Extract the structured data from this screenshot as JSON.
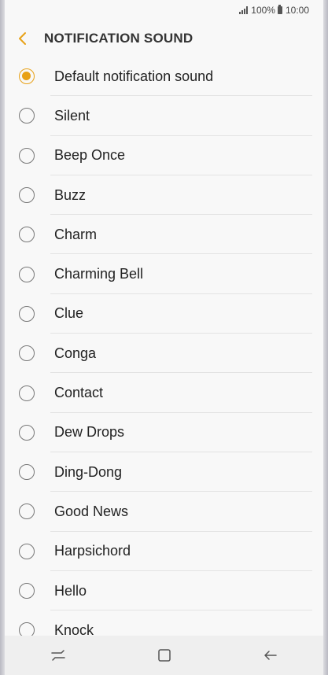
{
  "status_bar": {
    "battery": "100%",
    "time": "10:00"
  },
  "header": {
    "title": "NOTIFICATION SOUND",
    "back_icon": "chevron-left-icon"
  },
  "colors": {
    "accent": "#e8a116"
  },
  "sounds": [
    {
      "label": "Default notification sound",
      "selected": true
    },
    {
      "label": "Silent",
      "selected": false
    },
    {
      "label": "Beep Once",
      "selected": false
    },
    {
      "label": "Buzz",
      "selected": false
    },
    {
      "label": "Charm",
      "selected": false
    },
    {
      "label": "Charming Bell",
      "selected": false
    },
    {
      "label": "Clue",
      "selected": false
    },
    {
      "label": "Conga",
      "selected": false
    },
    {
      "label": "Contact",
      "selected": false
    },
    {
      "label": "Dew Drops",
      "selected": false
    },
    {
      "label": "Ding-Dong",
      "selected": false
    },
    {
      "label": "Good News",
      "selected": false
    },
    {
      "label": "Harpsichord",
      "selected": false
    },
    {
      "label": "Hello",
      "selected": false
    },
    {
      "label": "Knock",
      "selected": false
    }
  ],
  "nav_bar": {
    "recents_icon": "recents-icon",
    "home_icon": "home-icon",
    "back_icon": "back-arrow-icon"
  }
}
